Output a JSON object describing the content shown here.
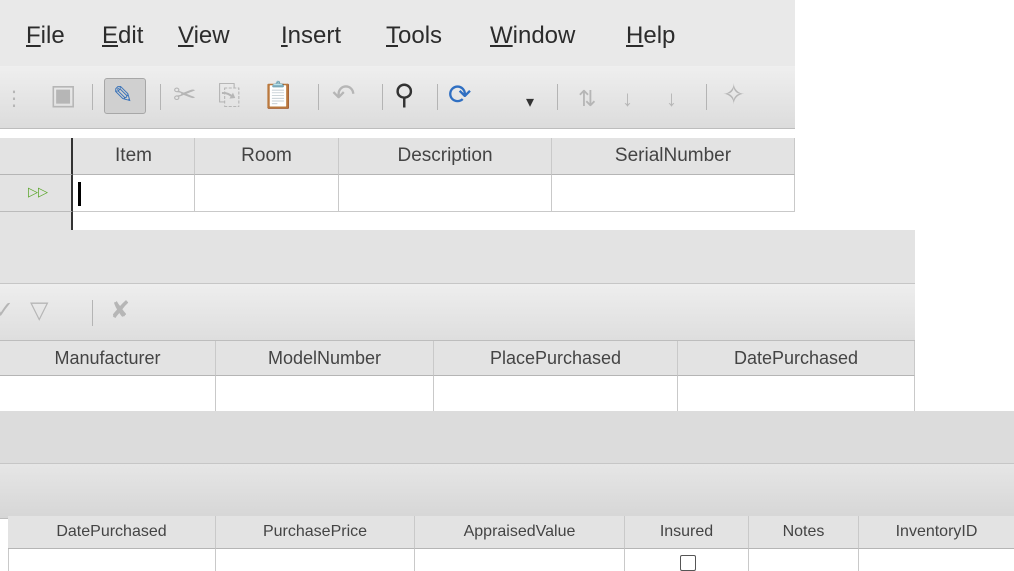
{
  "menu": {
    "file": {
      "mnemonic": "F",
      "rest": "ile"
    },
    "edit": {
      "mnemonic": "E",
      "rest": "dit"
    },
    "view": {
      "mnemonic": "V",
      "rest": "iew"
    },
    "insert": {
      "mnemonic": "I",
      "rest": "nsert"
    },
    "tools": {
      "mnemonic": "T",
      "rest": "ools"
    },
    "window": {
      "mnemonic": "W",
      "rest": "indow"
    },
    "help": {
      "mnemonic": "H",
      "rest": "elp"
    }
  },
  "toolbar": {
    "icons": [
      "save-icon",
      "edit-icon",
      "cut-icon",
      "copy-icon",
      "paste-icon",
      "undo-icon",
      "find-icon",
      "refresh-icon",
      "sort-ascending-icon",
      "sort-descending-icon",
      "autofilter-icon",
      "standard-filter-icon",
      "remove-filter-icon"
    ],
    "glyphs": {
      "grip": "⋮",
      "save": "▣",
      "edit": "✎",
      "cut": "✂",
      "copy": "⎘",
      "paste": "📋",
      "undo": "↶",
      "find": "⚲",
      "refresh": "⟳",
      "dropdown": "▾",
      "sort_az": "⇅",
      "sort_asc": "↓",
      "sort_desc": "↓",
      "autofilter": "✧",
      "filter": "✓",
      "filter2": "▽",
      "remove_filter": "✘"
    }
  },
  "table1": {
    "columns": [
      "Item",
      "Room",
      "Description",
      "SerialNumber"
    ],
    "row_marker": "▷▷"
  },
  "table2": {
    "columns": [
      "Manufacturer",
      "ModelNumber",
      "PlacePurchased",
      "DatePurchased"
    ]
  },
  "table3": {
    "columns": [
      "DatePurchased",
      "PurchasePrice",
      "AppraisedValue",
      "Insured",
      "Notes",
      "InventoryID"
    ]
  },
  "colors": {
    "menubar": "#e9e9e9",
    "header": "#e3e3e3",
    "row_marker": "#5aa62a",
    "edit_icon": "#3a73b9",
    "refresh_icon": "#2f6fc2"
  }
}
